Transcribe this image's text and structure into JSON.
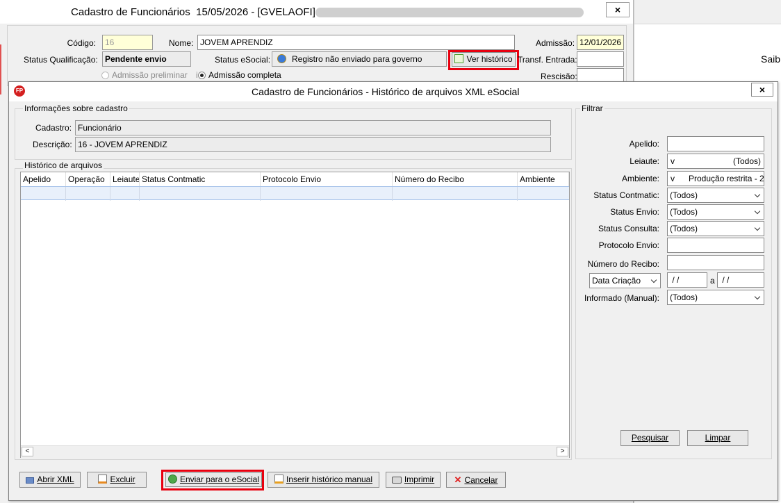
{
  "main_window": {
    "title": "Cadastro de Funcionários  15/05/2026 - [GVELAOFI] -",
    "codigo_label": "Código:",
    "codigo_value": "16",
    "nome_label": "Nome:",
    "nome_value": "JOVEM APRENDIZ",
    "admissao_label": "Admissão:",
    "admissao_value": "12/01/2026",
    "status_qualificacao_label": "Status Qualificação:",
    "status_qualificacao_value": "Pendente envio",
    "status_esocial_label": "Status eSocial:",
    "status_esocial_value": "Registro não enviado para governo",
    "ver_historico_label": "Ver histórico",
    "transf_entrada_label": "Transf. Entrada:",
    "rescisao_label": "Rescisão:",
    "admissao_preliminar_label": "Admissão preliminar",
    "admissao_completa_label": "Admissão completa",
    "side_text": "Saib"
  },
  "dialog": {
    "title": "Cadastro de Funcionários - Histórico de arquivos XML eSocial",
    "app_logo": "FP",
    "info_group_label": "Informações sobre cadastro",
    "cadastro_label": "Cadastro:",
    "cadastro_value": "Funcionário",
    "descricao_label": "Descrição:",
    "descricao_value": "16 - JOVEM APRENDIZ",
    "historico_group_label": "Histórico de arquivos",
    "columns": [
      "Apelido",
      "Operação",
      "Leiaute",
      "Status Contmatic",
      "Protocolo Envio",
      "Número do Recibo",
      "Ambiente"
    ],
    "filter": {
      "group_label": "Filtrar",
      "apelido_label": "Apelido:",
      "apelido_value": "",
      "leiaute_label": "Leiaute:",
      "leiaute_value": "(Todos)",
      "ambiente_label": "Ambiente:",
      "ambiente_value": "Produção restrita - 2",
      "status_contmatic_label": "Status Contmatic:",
      "status_contmatic_value": "(Todos)",
      "status_envio_label": "Status Envio:",
      "status_envio_value": "(Todos)",
      "status_consulta_label": "Status Consulta:",
      "status_consulta_value": "(Todos)",
      "protocolo_label": "Protocolo Envio:",
      "numero_recibo_label": "Número do Recibo:",
      "data_tipo_value": "Data Criação",
      "date_from": " / /",
      "date_sep": "a",
      "date_to": " / /",
      "informado_label": "Informado (Manual):",
      "informado_value": "(Todos)",
      "pesquisar_label": "Pesquisar",
      "limpar_label": "Limpar"
    },
    "buttons": {
      "abrir_xml": "Abrir XML",
      "excluir": "Excluir",
      "enviar": "Enviar para o eSocial",
      "inserir": "Inserir histórico manual",
      "imprimir": "Imprimir",
      "cancelar": "Cancelar"
    }
  }
}
